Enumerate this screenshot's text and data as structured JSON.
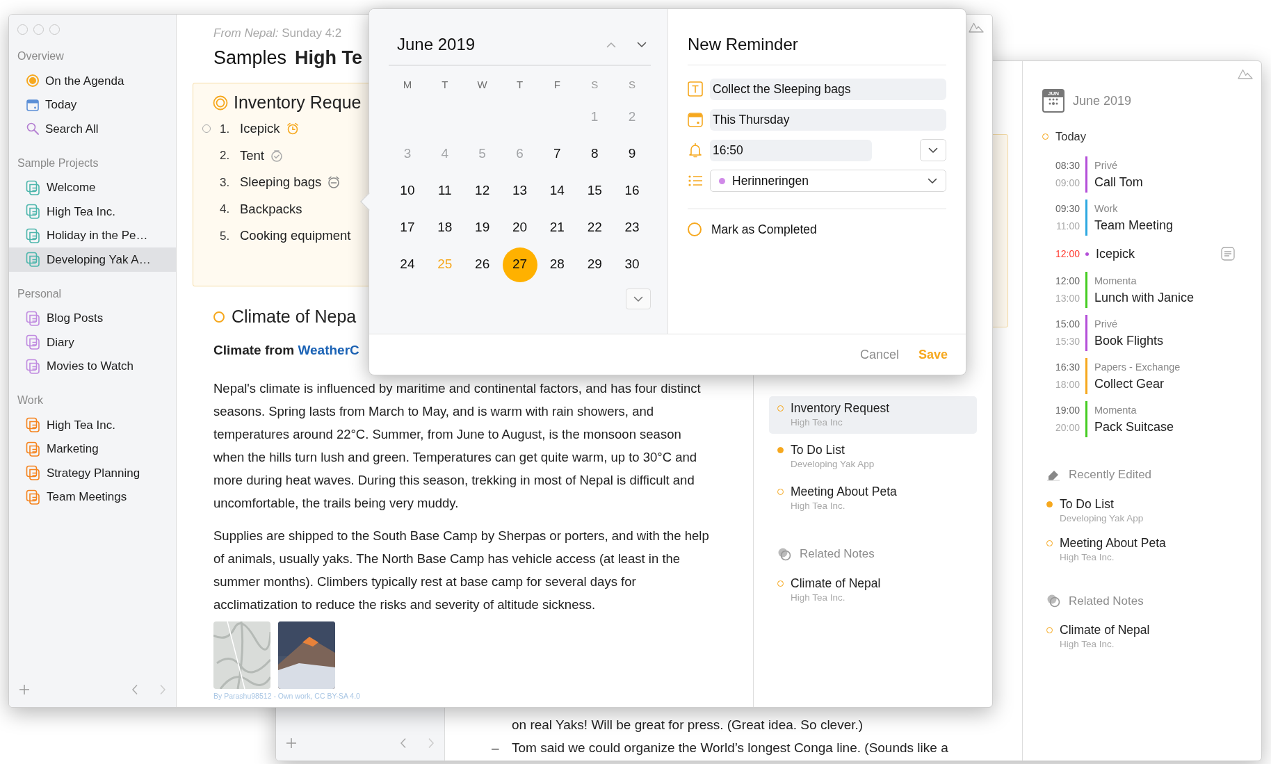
{
  "back_window": {
    "note_lines": [
      {
        "text": "on real Yaks! Will be great for press. (Great idea. So clever.)"
      },
      {
        "marker": "–",
        "text": "Tom said we could organize the World’s longest Conga line. (Sounds like a"
      }
    ],
    "agenda": {
      "icon_month": "JUN",
      "month": "June 2019",
      "day": "Today",
      "events": [
        {
          "kind": "event",
          "start": "08:30",
          "end": "09:00",
          "calendar": "Privé",
          "title": "Call Tom",
          "color": "#b44fd8"
        },
        {
          "kind": "event",
          "start": "09:30",
          "end": "11:00",
          "calendar": "Work",
          "title": "Team Meeting",
          "color": "#2ea8e0"
        },
        {
          "kind": "reminder",
          "start": "12:00",
          "title": "Icepick",
          "color": "#b44fd8"
        },
        {
          "kind": "event",
          "start": "12:00",
          "end": "13:00",
          "calendar": "Momenta",
          "title": "Lunch with Janice",
          "color": "#45cc22"
        },
        {
          "kind": "event",
          "start": "15:00",
          "end": "15:30",
          "calendar": "Privé",
          "title": "Book Flights",
          "color": "#b44fd8"
        },
        {
          "kind": "event",
          "start": "16:30",
          "end": "18:00",
          "calendar": "Papers - Exchange",
          "title": "Collect Gear",
          "color": "#f6a81e"
        },
        {
          "kind": "event",
          "start": "19:00",
          "end": "20:00",
          "calendar": "Momenta",
          "title": "Pack Suitcase",
          "color": "#45cc22"
        }
      ],
      "recent_title": "Recently Edited",
      "recent": [
        {
          "title": "To Do List",
          "notebook": "Developing Yak App",
          "filled": true
        },
        {
          "title": "Meeting About Peta",
          "notebook": "High Tea Inc.",
          "filled": false
        }
      ],
      "related_title": "Related Notes",
      "related": [
        {
          "title": "Climate of Nepal",
          "notebook": "High Tea Inc.",
          "filled": false
        }
      ]
    }
  },
  "front_window": {
    "sidebar": {
      "sections": [
        {
          "title": "Overview",
          "items": [
            {
              "label": "On the Agenda",
              "kind": "agenda",
              "selected": false
            },
            {
              "label": "Today",
              "kind": "today",
              "selected": false
            },
            {
              "label": "Search All",
              "kind": "search",
              "selected": false
            }
          ]
        },
        {
          "title": "Sample Projects",
          "items": [
            {
              "label": "Welcome",
              "kind": "notebook",
              "color": "#4db6ac",
              "selected": false
            },
            {
              "label": "High Tea Inc.",
              "kind": "notebook",
              "color": "#4db6ac",
              "selected": false
            },
            {
              "label": "Holiday in the Pe…",
              "kind": "notebook",
              "color": "#4db6ac",
              "selected": false
            },
            {
              "label": "Developing Yak A…",
              "kind": "notebook",
              "color": "#4db6ac",
              "selected": true
            }
          ]
        },
        {
          "title": "Personal",
          "items": [
            {
              "label": "Blog Posts",
              "kind": "notebook",
              "color": "#c08be0",
              "selected": false
            },
            {
              "label": "Diary",
              "kind": "notebook",
              "color": "#c08be0",
              "selected": false
            },
            {
              "label": "Movies to Watch",
              "kind": "notebook",
              "color": "#c08be0",
              "selected": false
            }
          ]
        },
        {
          "title": "Work",
          "items": [
            {
              "label": "High Tea Inc.",
              "kind": "notebook",
              "color": "#f5841f",
              "selected": false
            },
            {
              "label": "Marketing",
              "kind": "notebook",
              "color": "#f5841f",
              "selected": false
            },
            {
              "label": "Strategy Planning",
              "kind": "notebook",
              "color": "#f5841f",
              "selected": false
            },
            {
              "label": "Team Meetings",
              "kind": "notebook",
              "color": "#f5841f",
              "selected": false
            }
          ]
        }
      ]
    },
    "note": {
      "meta": "*From Nepal:* Sunday 4:2",
      "breadcrumb": "Samples",
      "title": "High Te",
      "card": {
        "title": "Inventory Reque",
        "tasks": [
          {
            "number": "1.",
            "label": "Icepick",
            "kind": "alarm",
            "current": true
          },
          {
            "number": "2.",
            "label": "Tent",
            "kind": "checked",
            "current": false
          },
          {
            "number": "3.",
            "label": "Sleeping bags",
            "kind": "snoozed",
            "current": false
          },
          {
            "number": "4.",
            "label": "Backpacks",
            "kind": "plain",
            "current": false
          },
          {
            "number": "5.",
            "label": "Cooking equipment",
            "kind": "plain",
            "current": false
          }
        ]
      },
      "section_title": "Climate of Nepa",
      "heading": {
        "text": "Climate from",
        "link": "WeatherC"
      },
      "paragraphs": [
        "Nepal's climate is influenced by maritime and continental factors, and has four distinct seasons. Spring lasts from March to May, and is warm with rain showers, and temperatures around 22°C. Summer, from June to August, is the monsoon season when the hills turn lush and green. Temperatures can get quite warm, up to 30°C and more during heat waves. During this season, trekking in most of Nepal is difficult and uncomfortable, the trails being very muddy.",
        "Supplies are shipped to the South Base Camp by Sherpas or porters, and with the help of animals, usually yaks. The North Base Camp has vehicle access (at least in the summer months). Climbers typically rest at base camp for several days for acclimatization to reduce the risks and severity of altitude sickness."
      ],
      "photos": [
        {
          "kind": "map"
        },
        {
          "kind": "mountain"
        }
      ],
      "photo_credit": "By Parashu98512 - Own work, CC BY-SA 4.0"
    },
    "panel": {
      "notes": [
        {
          "title": "Inventory Request",
          "notebook": "High Tea Inc",
          "filled": false,
          "selected": true
        },
        {
          "title": "To Do List",
          "notebook": "Developing Yak App",
          "filled": true,
          "selected": false
        },
        {
          "title": "Meeting About Peta",
          "notebook": "High Tea Inc.",
          "filled": false,
          "selected": false
        }
      ],
      "related_title": "Related Notes",
      "related": [
        {
          "title": "Climate of Nepal",
          "notebook": "High Tea Inc.",
          "filled": false,
          "selected": false
        }
      ]
    }
  },
  "reminder_popup": {
    "calendar": {
      "month": "June 2019",
      "weekdays": [
        {
          "label": "M",
          "weekend": false
        },
        {
          "label": "T",
          "weekend": false
        },
        {
          "label": "W",
          "weekend": false
        },
        {
          "label": "T",
          "weekend": false
        },
        {
          "label": "F",
          "weekend": false
        },
        {
          "label": "S",
          "weekend": true
        },
        {
          "label": "S",
          "weekend": true
        }
      ],
      "weeks": [
        [
          {
            "day": "1",
            "faded": true,
            "today": false,
            "selected": false
          },
          {
            "day": "2",
            "faded": true,
            "today": false,
            "selected": false
          }
        ],
        [
          {
            "day": "3",
            "faded": true,
            "today": false,
            "selected": false
          },
          {
            "day": "4",
            "faded": true,
            "today": false,
            "selected": false
          },
          {
            "day": "5",
            "faded": true,
            "today": false,
            "selected": false
          },
          {
            "day": "6",
            "faded": true,
            "today": false,
            "selected": false
          },
          {
            "day": "7",
            "faded": false,
            "today": false,
            "selected": false
          },
          {
            "day": "8",
            "faded": false,
            "today": false,
            "selected": false
          },
          {
            "day": "9",
            "faded": false,
            "today": false,
            "selected": false
          }
        ],
        [
          {
            "day": "10",
            "faded": false,
            "today": false,
            "selected": false
          },
          {
            "day": "11",
            "faded": false,
            "today": false,
            "selected": false
          },
          {
            "day": "12",
            "faded": false,
            "today": false,
            "selected": false
          },
          {
            "day": "13",
            "faded": false,
            "today": false,
            "selected": false
          },
          {
            "day": "14",
            "faded": false,
            "today": false,
            "selected": false
          },
          {
            "day": "15",
            "faded": false,
            "today": false,
            "selected": false
          },
          {
            "day": "16",
            "faded": false,
            "today": false,
            "selected": false
          }
        ],
        [
          {
            "day": "17",
            "faded": false,
            "today": false,
            "selected": false
          },
          {
            "day": "18",
            "faded": false,
            "today": false,
            "selected": false
          },
          {
            "day": "19",
            "faded": false,
            "today": false,
            "selected": false
          },
          {
            "day": "20",
            "faded": false,
            "today": false,
            "selected": false
          },
          {
            "day": "21",
            "faded": false,
            "today": false,
            "selected": false
          },
          {
            "day": "22",
            "faded": false,
            "today": false,
            "selected": false
          },
          {
            "day": "23",
            "faded": false,
            "today": false,
            "selected": false
          }
        ],
        [
          {
            "day": "24",
            "faded": false,
            "today": false,
            "selected": false
          },
          {
            "day": "25",
            "faded": false,
            "today": true,
            "selected": false
          },
          {
            "day": "26",
            "faded": false,
            "today": false,
            "selected": false
          },
          {
            "day": "27",
            "faded": false,
            "today": false,
            "selected": true
          },
          {
            "day": "28",
            "faded": false,
            "today": false,
            "selected": false
          },
          {
            "day": "29",
            "faded": false,
            "today": false,
            "selected": false
          },
          {
            "day": "30",
            "faded": false,
            "today": false,
            "selected": false
          }
        ]
      ]
    },
    "title": "New Reminder",
    "name": "Collect the Sleeping bags",
    "date": "This Thursday",
    "time": "16:50",
    "list": {
      "name": "Herinneringen",
      "color": "#d08ae8"
    },
    "completed": {
      "label": "Mark as Completed",
      "checked": false
    },
    "buttons": [
      {
        "label": "Cancel",
        "primary": false
      },
      {
        "label": "Save",
        "primary": true
      }
    ]
  }
}
